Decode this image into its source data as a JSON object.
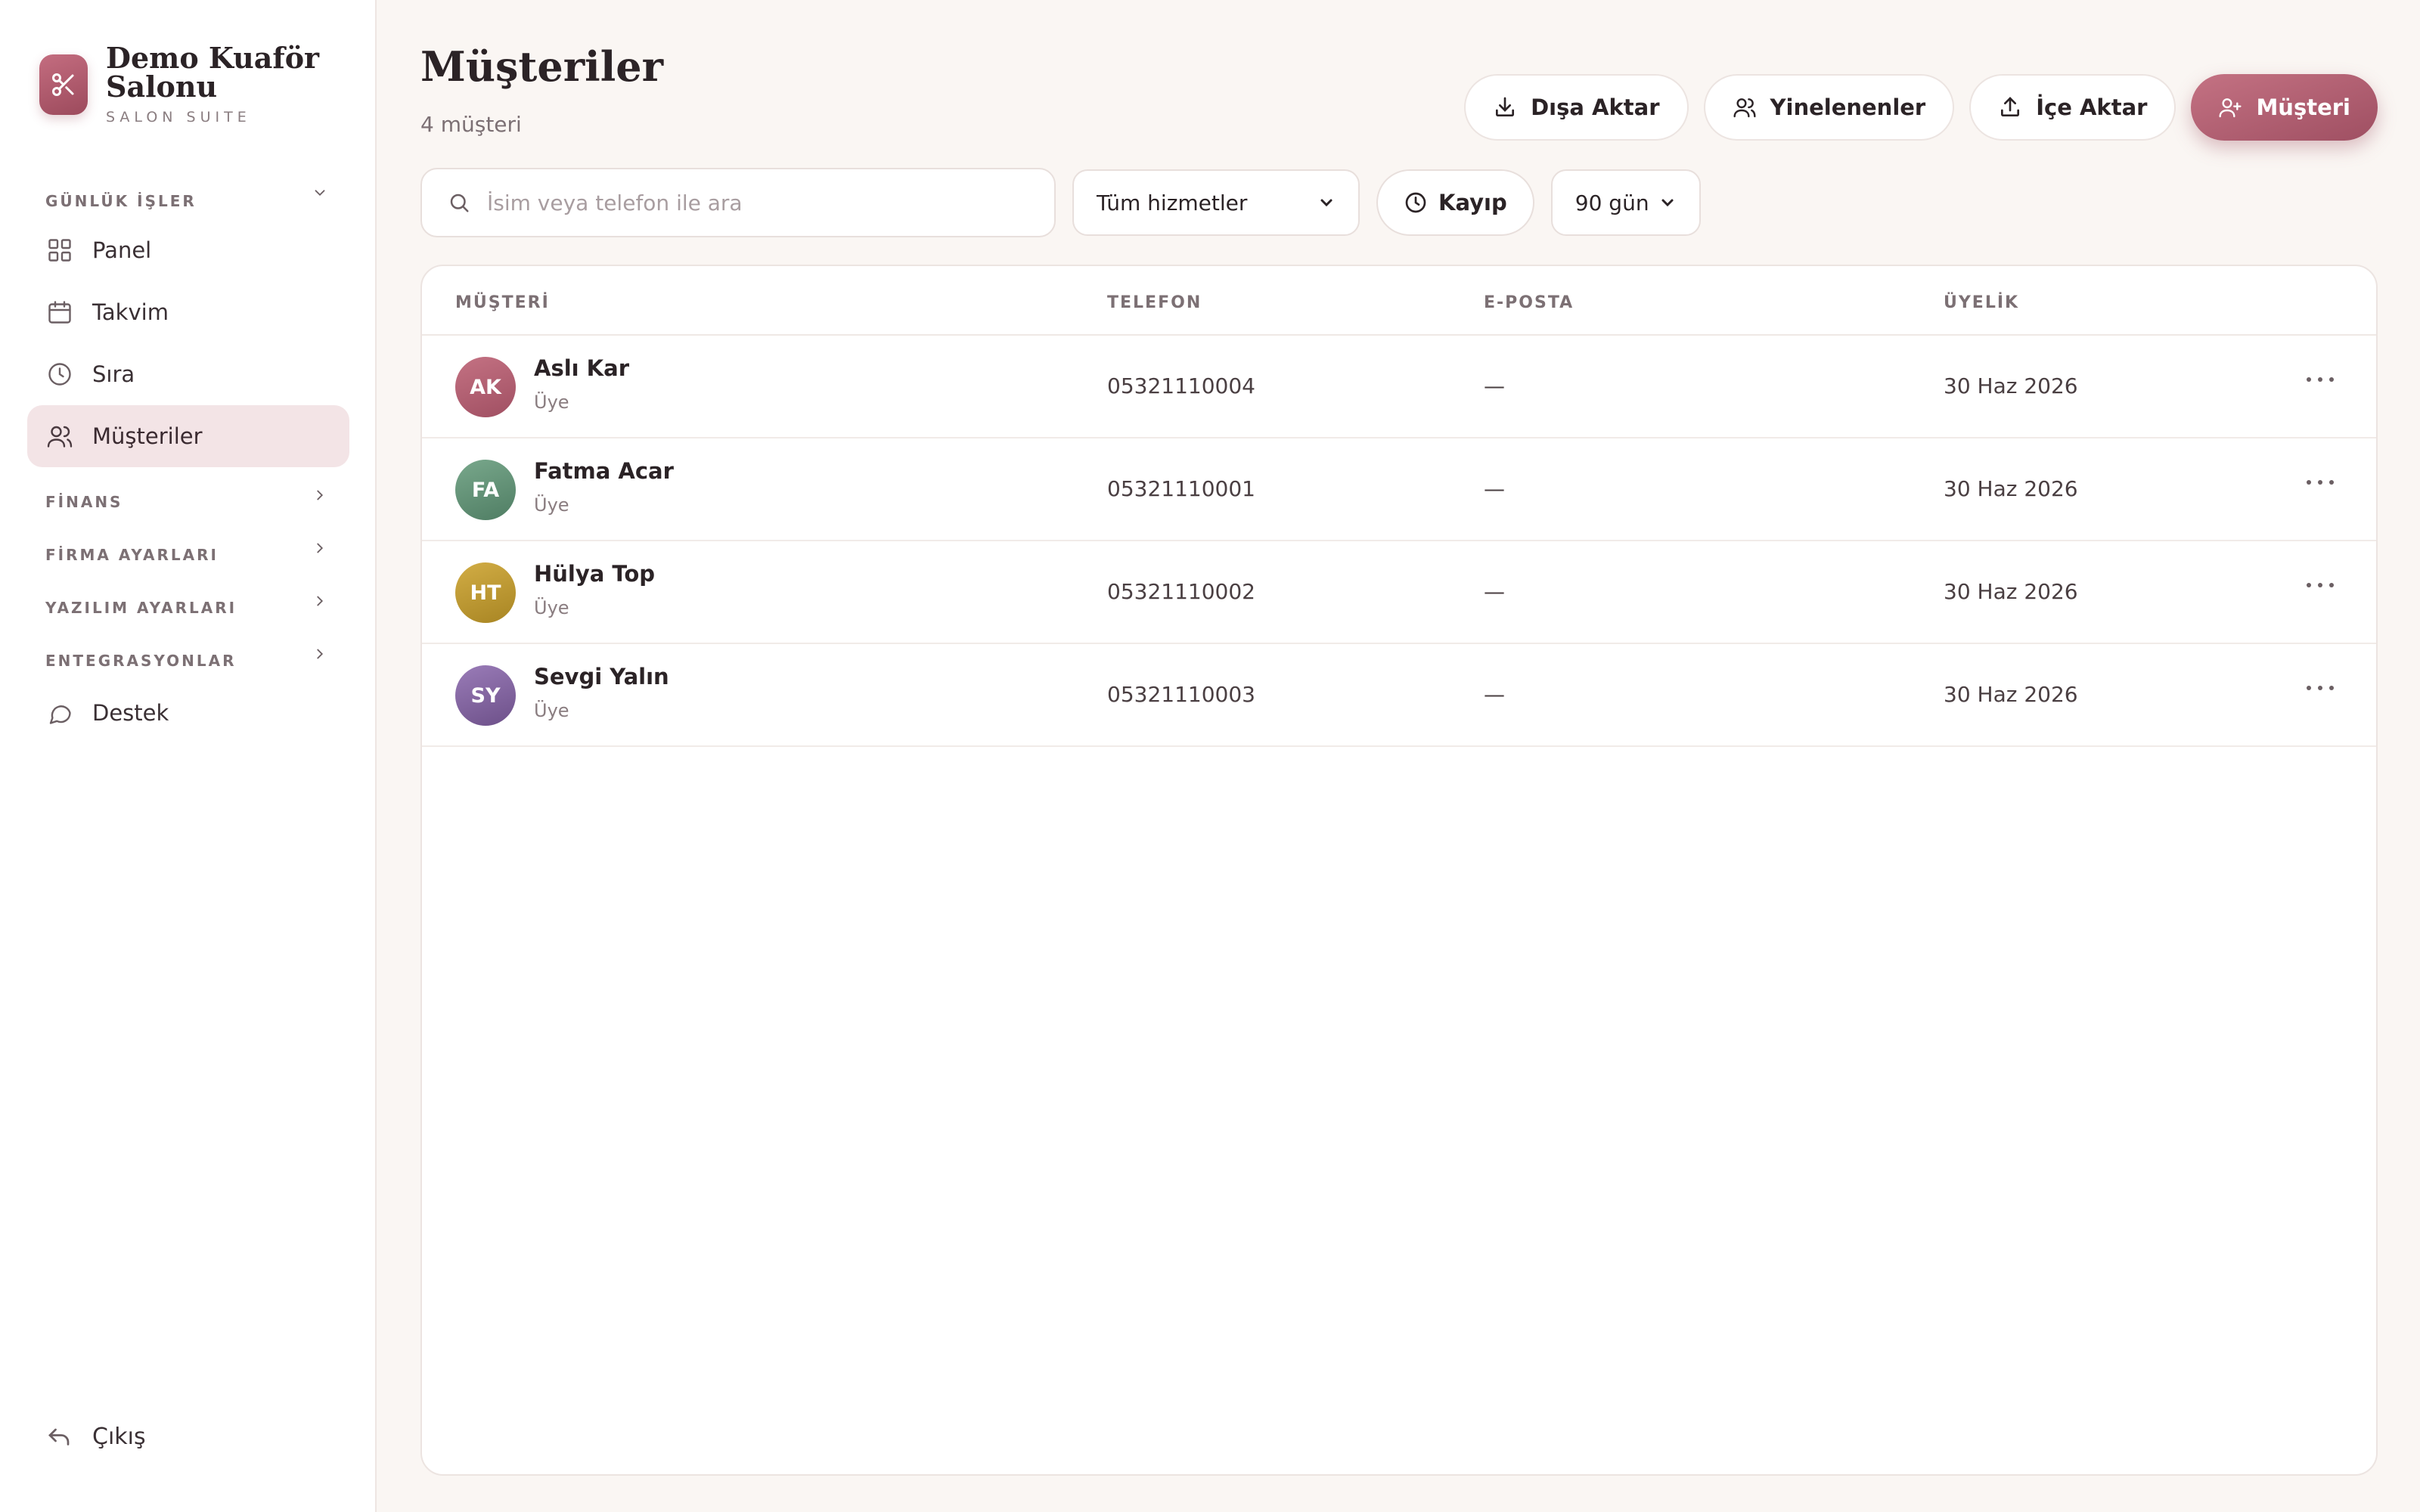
{
  "brand": {
    "name": "Demo Kuaför Salonu",
    "subtitle": "SALON SUITE"
  },
  "sidebar": {
    "sections": {
      "daily": "GÜNLÜK İŞLER",
      "finance": "FİNANS",
      "company_settings": "FİRMA AYARLARI",
      "software_settings": "YAZILIM AYARLARI",
      "integrations": "ENTEGRASYONLAR"
    },
    "items": [
      {
        "label": "Panel",
        "icon": "grid-icon"
      },
      {
        "label": "Takvim",
        "icon": "calendar-icon"
      },
      {
        "label": "Sıra",
        "icon": "clock-icon"
      },
      {
        "label": "Müşteriler",
        "icon": "users-icon",
        "active": true
      },
      {
        "label": "Destek",
        "icon": "chat-bubble-icon"
      }
    ],
    "logout_label": "Çıkış"
  },
  "header": {
    "title": "Müşteriler",
    "count": "4 müşteri"
  },
  "actions": {
    "export": "Dışa Aktar",
    "duplicates": "Yinelenenler",
    "import": "İçe Aktar",
    "add_customer": "Müşteri"
  },
  "filters": {
    "search_placeholder": "İsim veya telefon ile ara",
    "services_selected": "Tüm hizmetler",
    "lost_label": "Kayıp",
    "days_selected": "90 gün"
  },
  "table": {
    "columns": [
      "MÜŞTERİ",
      "TELEFON",
      "E-POSTA",
      "ÜYELİK"
    ],
    "rows": [
      {
        "initials": "AK",
        "name": "Aslı Kar",
        "status": "Üye",
        "phone": "05321110004",
        "email": "—",
        "membership": "30 Haz 2026",
        "color": "#b25f70"
      },
      {
        "initials": "FA",
        "name": "Fatma Acar",
        "status": "Üye",
        "phone": "05321110001",
        "email": "—",
        "membership": "30 Haz 2026",
        "color": "#5f8e73"
      },
      {
        "initials": "HT",
        "name": "Hülya Top",
        "status": "Üye",
        "phone": "05321110002",
        "email": "—",
        "membership": "30 Haz 2026",
        "color": "#b8962e"
      },
      {
        "initials": "SY",
        "name": "Sevgi Yalın",
        "status": "Üye",
        "phone": "05321110003",
        "email": "—",
        "membership": "30 Haz 2026",
        "color": "#7c5f9a"
      }
    ]
  },
  "colors": {
    "accent": "#a8566a",
    "active_nav_bg": "#f3e4e6",
    "page_bg": "#faf6f3"
  }
}
